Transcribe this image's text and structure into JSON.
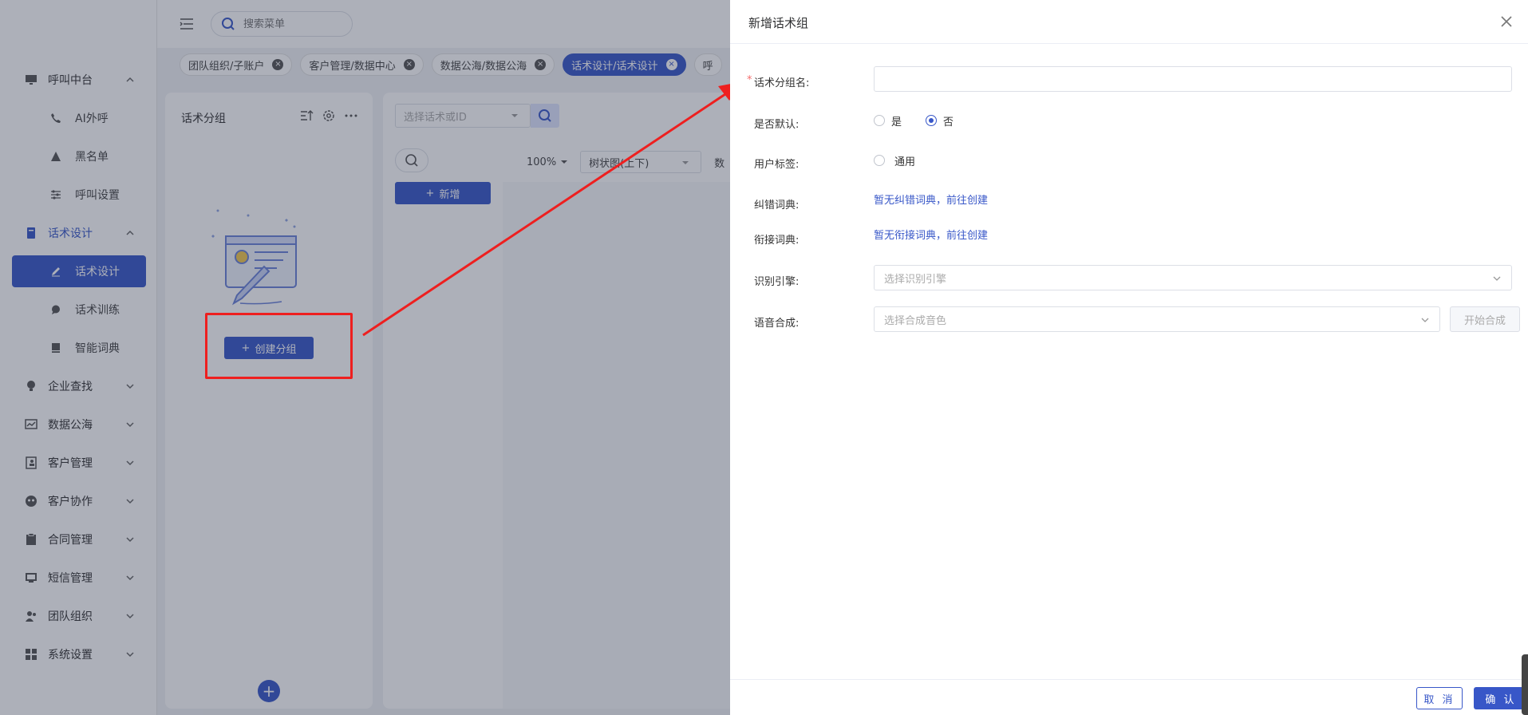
{
  "header": {
    "search_placeholder": "搜索菜单"
  },
  "sidebar": {
    "items": [
      {
        "label": "呼叫中台",
        "icon": "monitor-icon",
        "expanded": true,
        "children": [
          {
            "label": "AI外呼",
            "icon": "phone-icon"
          },
          {
            "label": "黑名单",
            "icon": "warning-icon"
          },
          {
            "label": "呼叫设置",
            "icon": "sliders-icon"
          }
        ]
      },
      {
        "label": "话术设计",
        "icon": "book-icon",
        "expanded": true,
        "children": [
          {
            "label": "话术设计",
            "icon": "pen-icon",
            "active": true
          },
          {
            "label": "话术训练",
            "icon": "chat-icon"
          },
          {
            "label": "智能词典",
            "icon": "dictionary-icon"
          }
        ]
      },
      {
        "label": "企业查找",
        "icon": "bulb-icon"
      },
      {
        "label": "数据公海",
        "icon": "chart-icon"
      },
      {
        "label": "客户管理",
        "icon": "contacts-icon"
      },
      {
        "label": "客户协作",
        "icon": "collab-icon"
      },
      {
        "label": "合同管理",
        "icon": "clipboard-icon"
      },
      {
        "label": "短信管理",
        "icon": "message-icon"
      },
      {
        "label": "团队组织",
        "icon": "team-icon"
      },
      {
        "label": "系统设置",
        "icon": "grid-icon"
      }
    ]
  },
  "tabs": [
    {
      "label": "团队组织/子账户",
      "active": false
    },
    {
      "label": "客户管理/数据中心",
      "active": false
    },
    {
      "label": "数据公海/数据公海",
      "active": false
    },
    {
      "label": "话术设计/话术设计",
      "active": true
    },
    {
      "label": "呼",
      "active": false
    }
  ],
  "group_panel": {
    "title": "话术分组",
    "create_button": "创建分组"
  },
  "mid_panel": {
    "select_placeholder": "选择话术或ID",
    "add_button": "新增",
    "zoom": "100%",
    "view_mode": "树状图(上下)",
    "extra": "数"
  },
  "drawer": {
    "title": "新增话术组",
    "fields": {
      "group_name_label": "话术分组名:",
      "group_name_value": "",
      "is_default_label": "是否默认:",
      "is_default_options": [
        "是",
        "否"
      ],
      "is_default_selected": "否",
      "user_tag_label": "用户标签:",
      "user_tag_option": "通用",
      "correction_dict_label": "纠错词典:",
      "correction_dict_link": "暂无纠错词典，前往创建",
      "transition_dict_label": "衔接词典:",
      "transition_dict_link": "暂无衔接词典，前往创建",
      "engine_label": "识别引擎:",
      "engine_placeholder": "选择识别引擎",
      "tts_label": "语音合成:",
      "tts_placeholder": "选择合成音色",
      "tts_button": "开始合成"
    },
    "footer": {
      "cancel": "取 消",
      "confirm": "确 认"
    }
  },
  "colors": {
    "accent": "#3857c8",
    "annotation": "#ee1f1f",
    "required": "#f56c6c",
    "link": "#3857c8"
  }
}
